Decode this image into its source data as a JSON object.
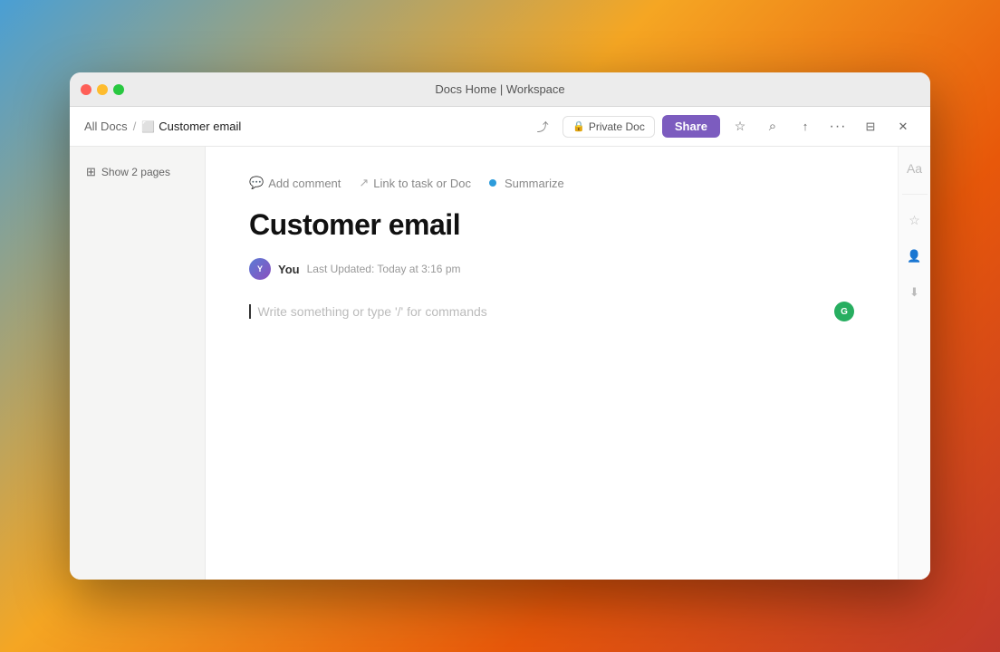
{
  "window": {
    "title": "Docs Home | Workspace",
    "titlebar": {
      "title": "Docs Home | Workspace"
    }
  },
  "toolbar": {
    "breadcrumb": {
      "parent": "All Docs",
      "separator": "/",
      "current": "Customer email"
    },
    "private_doc_label": "Private Doc",
    "share_label": "Share"
  },
  "sidebar": {
    "show_pages_label": "Show 2 pages"
  },
  "doc_toolbar": {
    "add_comment": "Add comment",
    "link_task": "Link to task or Doc",
    "summarize": "Summarize"
  },
  "document": {
    "title": "Customer email",
    "author": "You",
    "last_updated": "Last Updated: Today at 3:16 pm",
    "placeholder": "Write something or type '/' for commands"
  },
  "right_panel": {
    "icons": [
      "text-size",
      "star",
      "person-add",
      "download"
    ]
  },
  "icons": {
    "close": "●",
    "minimize": "●",
    "maximize": "●",
    "comment": "○",
    "link": "↗",
    "lock": "🔒",
    "star": "☆",
    "search": "⌕",
    "export": "↑",
    "more": "···",
    "minimize_window": "⊟",
    "close_window": "✕",
    "doc": "📄",
    "pages": "⊞"
  },
  "colors": {
    "share_bg": "#7c5cbf",
    "share_text": "#ffffff",
    "ai_dot": "#27ae60",
    "summarize_dot": "#2d9cdb"
  }
}
